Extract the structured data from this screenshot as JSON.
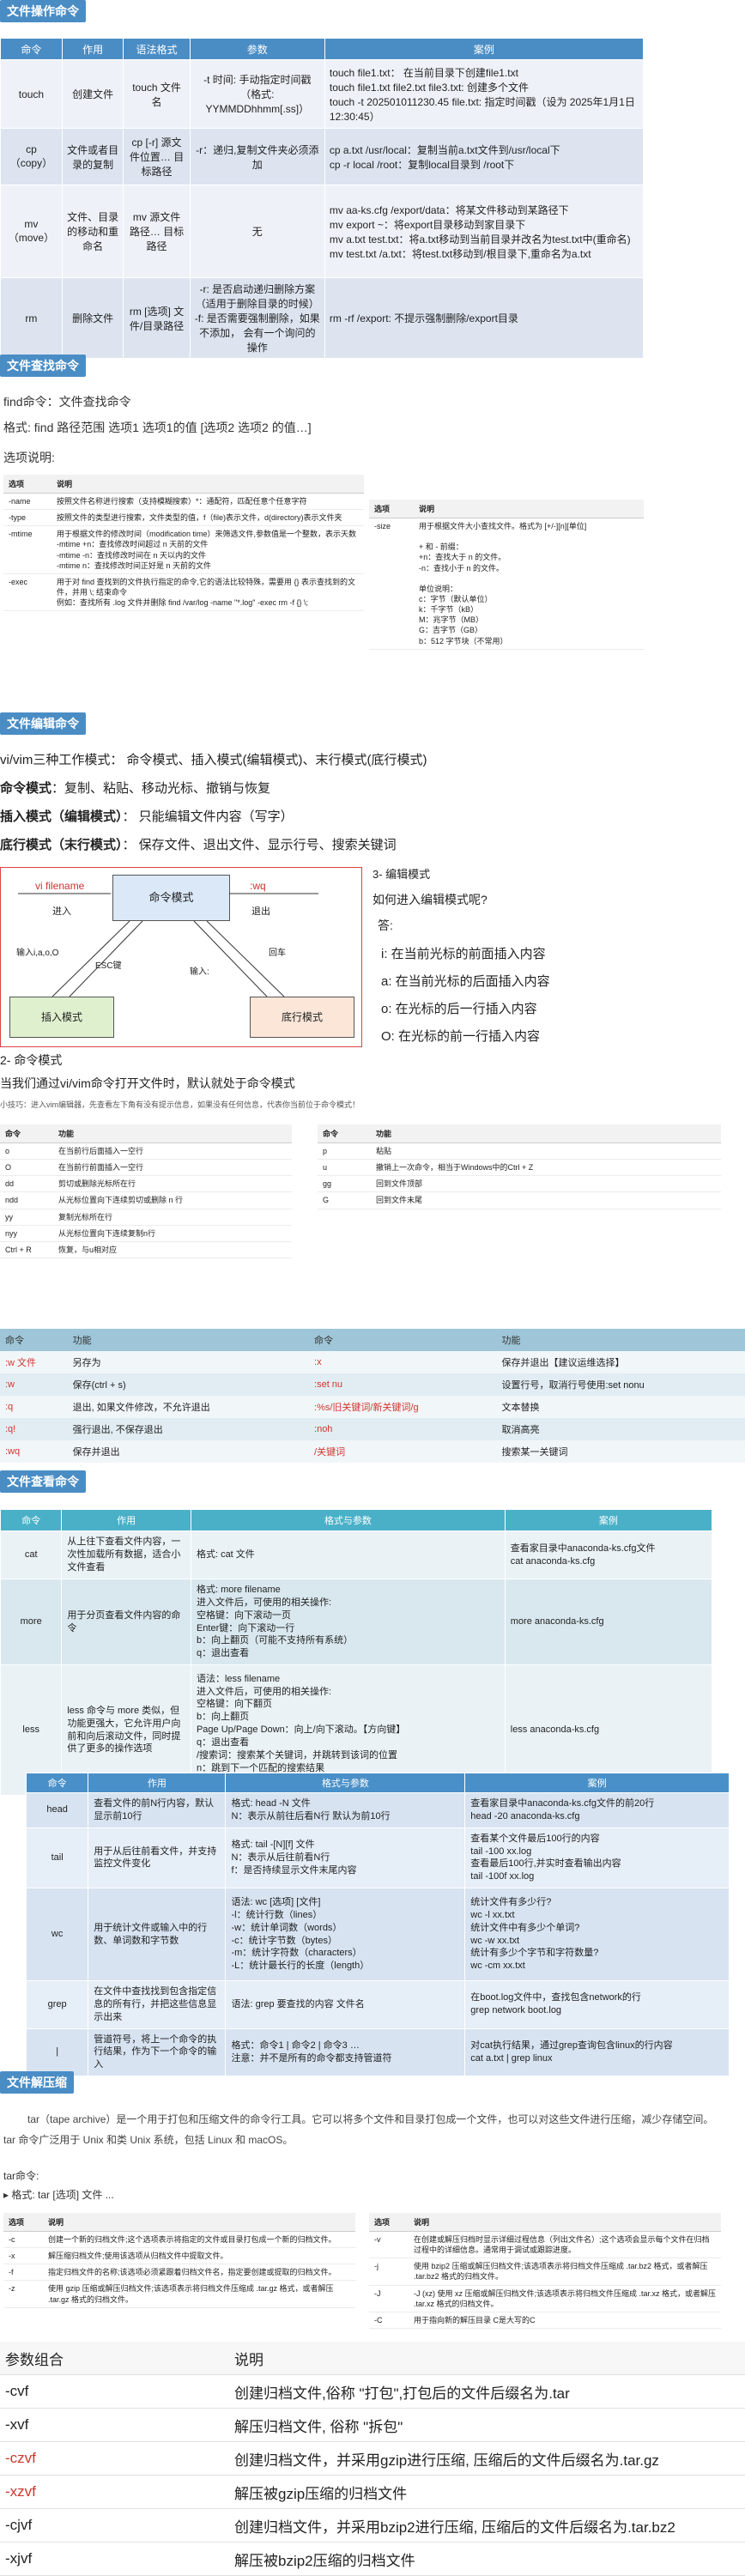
{
  "sec_file_ops": "文件操作命令",
  "t1": {
    "headers": [
      "命令",
      "作用",
      "语法格式",
      "参数",
      "案例"
    ],
    "rows": [
      {
        "cmd": "touch",
        "use": "创建文件",
        "syntax": "touch 文件名",
        "params": "-t 时间: 手动指定时间戳（格式: YYMMDDhhmm[.ss]）",
        "example": "touch file1.txt： 在当前目录下创建file1.txt\ntouch file1.txt file2.txt file3.txt: 创建多个文件\ntouch -t 202501011230.45 file.txt: 指定时间戳（设为 2025年1月1日 12:30:45）"
      },
      {
        "cmd": "cp\n（copy）",
        "use": "文件或者目录的复制",
        "syntax": "cp [-r] 源文件位置… 目标路径",
        "params": "-r：递归,复制文件夹必须添加",
        "example": "cp a.txt /usr/local：复制当前a.txt文件到/usr/local下\ncp -r local /root：复制local目录到 /root下"
      },
      {
        "cmd": "mv\n（move）",
        "use": "文件、目录的移动和重命名",
        "syntax": "mv 源文件路径… 目标路径",
        "params": "无",
        "example": "mv aa-ks.cfg /export/data：将某文件移动到某路径下\nmv export ~：将export目录移动到家目录下\nmv a.txt test.txt：将a.txt移动到当前目录并改名为test.txt中(重命名)\nmv test.txt /a.txt：将test.txt移动到/根目录下,重命名为a.txt"
      },
      {
        "cmd": "rm",
        "use": "删除文件",
        "syntax": "rm [选项] 文件/目录路径",
        "params": "-r: 是否启动递归删除方案（适用于删除目录的时候）\n-f: 是否需要强制删除，如果不添加， 会有一个询问的操作",
        "example": "rm -rf /export: 不提示强制删除/export目录"
      }
    ]
  },
  "sec_find": "文件查找命令",
  "find": {
    "line1": "find命令：文件查找命令",
    "line2": "格式: find  路径范围 选项1 选项1的值  [选项2 选项2 的值…]",
    "line3": "选项说明:",
    "left_headers": [
      "选项",
      "说明"
    ],
    "left_rows": [
      [
        "-name",
        "按照文件名称进行搜索（支持模糊搜索）*：通配符，匹配任意个任意字符"
      ],
      [
        "-type",
        "按照文件的类型进行搜索，文件类型的值，f（file)表示文件，d(directory)表示文件夹"
      ],
      [
        "-mtime",
        "用于根据文件的修改时间（modification time）来筛选文件,参数值是一个整数，表示天数\n-mtime +n：查找修改时间超过 n 天前的文件\n-mtime -n：查找修改时间在 n 天以内的文件\n-mtime n：查找修改时间正好是 n 天前的文件"
      ],
      [
        "-exec",
        "用于对 find 查找到的文件执行指定的命令,它的语法比较特殊，需要用 {} 表示查找到的文件，并用 \\; 结束命令\n例如：查找所有 .log 文件并删除 find /var/log -name \"*.log\" -exec rm -f {} \\;"
      ]
    ],
    "right_headers": [
      "选项",
      "说明"
    ],
    "right_rows": [
      [
        "-size",
        "用于根据文件大小查找文件。格式为 [+/-][n][单位]\n\n+ 和 - 前缀：\n+n：查找大于 n 的文件。\n-n：查找小于 n 的文件。\n\n单位说明：\nc：字节（默认单位）\nk：千字节（kB）\nM：兆字节（MB）\nG：吉字节（GB）\nb：512 字节块（不常用）"
      ]
    ]
  },
  "sec_edit": "文件编辑命令",
  "vim": {
    "l1": "vi/vim三种工作模式： 命令模式、插入模式(编辑模式)、末行模式(底行模式)",
    "l2b": "命令模式",
    "l2": "：复制、粘贴、移动光标、撤销与恢复",
    "l3b": "插入模式（编辑模式）",
    "l3": "： 只能编辑文件内容（写字）",
    "l4b": "底行模式（末行模式）",
    "l4": "： 保存文件、退出文件、显示行号、搜索关键词",
    "diag": {
      "vi": "vi filename",
      "enter": "进入",
      "cmdmode": "命令模式",
      "wq": ":wq",
      "exit": "退出",
      "input": "输入i,a,o,O",
      "esc": "ESC键",
      "enter2": "回车",
      "colon": "输入:",
      "insert": "插入模式",
      "bottom": "底行模式"
    },
    "q3": "3- 编辑模式",
    "q3a": "如何进入编辑模式呢?",
    "ans": "答:",
    "opts": [
      "i:  在当前光标的前面插入内容",
      "a:  在当前光标的后面插入内容",
      "o:  在光标的后一行插入内容",
      "O:  在光标的前一行插入内容"
    ],
    "q2": "2- 命令模式",
    "q2a": "当我们通过vi/vim命令打开文件时，默认就处于命令模式",
    "tip": "小技巧：进入vim编辑器，先查看左下角有没有提示信息，如果没有任何信息，代表你当前位于命令模式！"
  },
  "cmdtbl_left": {
    "headers": [
      "命令",
      "功能"
    ],
    "rows": [
      [
        "o",
        "在当前行后面插入一空行"
      ],
      [
        "O",
        "在当前行前面插入一空行"
      ],
      [
        "dd",
        "剪切或删除光标所在行"
      ],
      [
        "ndd",
        "从光标位置向下连续剪切或删除 n 行"
      ],
      [
        "yy",
        "复制光标所在行"
      ],
      [
        "nyy",
        "从光标位置向下连续复制n行"
      ],
      [
        "Ctrl + R",
        "恢复，与u相对应"
      ]
    ]
  },
  "cmdtbl_right": {
    "headers": [
      "命令",
      "功能"
    ],
    "rows": [
      [
        "p",
        "粘贴"
      ],
      [
        "u",
        "撤销上一次命令，相当于Windows中的Ctrl + Z"
      ],
      [
        "gg",
        "回到文件顶部"
      ],
      [
        "G",
        "回到文件末尾"
      ]
    ]
  },
  "vt": {
    "headers": [
      "命令",
      "功能",
      "命令",
      "功能"
    ],
    "rows": [
      [
        ":w 文件",
        "另存为",
        ":x",
        "保存并退出【建议运维选择】"
      ],
      [
        ":w",
        "保存(ctrl + s)",
        ":set nu",
        "设置行号，取消行号使用:set nonu"
      ],
      [
        ":q",
        "退出, 如果文件修改，不允许退出",
        ":%s/旧关键词/新关键词/g",
        "文本替换"
      ],
      [
        ":q!",
        "强行退出, 不保存退出",
        ":noh",
        "取消高亮"
      ],
      [
        ":wq",
        "保存并退出",
        "/关键词",
        "搜索某一关键词"
      ]
    ]
  },
  "sec_view": "文件查看命令",
  "t2": {
    "headers": [
      "命令",
      "作用",
      "格式与参数",
      "案例"
    ],
    "rows": [
      [
        "cat",
        "从上往下查看文件内容，一次性加载所有数据，适合小文件查看",
        "格式: cat 文件",
        "查看家目录中anaconda-ks.cfg文件\ncat anaconda-ks.cfg"
      ],
      [
        "more",
        "用于分页查看文件内容的命令",
        "格式: more  filename\n进入文件后，可使用的相关操作:\n空格键：向下滚动一页\nEnter键：向下滚动一行\nb：向上翻页（可能不支持所有系统）\nq：退出查看",
        "more anaconda-ks.cfg"
      ],
      [
        "less",
        "less 命令与 more 类似，但功能更强大，它允许用户向前和向后滚动文件，同时提供了更多的操作选项",
        "语法：less  filename\n进入文件后，可使用的相关操作:\n空格键：向下翻页\nb：向上翻页\nPage Up/Page Down：向上/向下滚动。【方向键】\nq：退出查看\n/搜索词：搜索某个关键词，并跳转到该词的位置\nn：跳到下一个匹配的搜索结果\nN：查看前一个匹配的搜索结果",
        "less anaconda-ks.cfg"
      ]
    ]
  },
  "t3": {
    "headers": [
      "命令",
      "作用",
      "格式与参数",
      "案例"
    ],
    "rows": [
      [
        "head",
        "查看文件的前N行内容，默认显示前10行",
        "格式: head -N 文件\nN：表示从前往后看N行 默认为前10行",
        "查看家目录中anaconda-ks.cfg文件的前20行\nhead -20 anaconda-ks.cfg"
      ],
      [
        "tail",
        "用于从后往前看文件，并支持监控文件变化",
        "格式: tail -[N][f] 文件\nN：表示从后往前看N行\nf：是否持续显示文件末尾内容",
        "查看某个文件最后100行的内容\ntail -100 xx.log\n查看最后100行,并实时查看输出内容\ntail -100f xx.log"
      ],
      [
        "wc",
        "用于统计文件或输入中的行数、单词数和字节数",
        "语法: wc [选项] [文件]\n-l：统计行数（lines）\n-w：统计单词数（words）\n-c：统计字节数（bytes）\n-m：统计字符数（characters）\n-L：统计最长行的长度（length）",
        "统计文件有多少行?\nwc -l xx.txt\n统计文件中有多少个单词?\nwc -w xx.txt\n统计有多少个字节和字符数量?\nwc -cm xx.txt"
      ],
      [
        "grep",
        "在文件中查找找到包含指定信息的所有行，并把这些信息显示出来",
        "语法: grep 要查找的内容 文件名",
        "在boot.log文件中，查找包含network的行\ngrep network boot.log"
      ],
      [
        "|",
        "管道符号，将上一个命令的执行结果，作为下一个命令的输入",
        "格式：命令1 | 命令2 | 命令3 …\n注意：并不是所有的命令都支持管道符",
        "对cat执行结果，通过grep查询包含linux的行内容\ncat a.txt | grep linux"
      ]
    ]
  },
  "sec_tar": "文件解压缩",
  "tar": {
    "p1": "tar（tape archive）是一个用于打包和压缩文件的命令行工具。它可以将多个文件和目录打包成一个文件，也可以对这些文件进行压缩，减少存储空间。tar 命令广泛用于 Unix 和类 Unix 系统，包括 Linux 和 macOS。",
    "l1": "tar命令:",
    "l2": "▸ 格式: tar [选项] 文件 ...",
    "left_headers": [
      "选项",
      "说明"
    ],
    "left_rows": [
      [
        "-c",
        "创建一个新的归档文件;这个选项表示将指定的文件或目录打包成一个新的归档文件。"
      ],
      [
        "-x",
        "解压缩归档文件;使用该选项从归档文件中提取文件。"
      ],
      [
        "-f",
        "指定归档文件的名称;该选项必须紧跟着归档文件名，指定要创建或提取的归档文件。"
      ],
      [
        "-z",
        "使用 gzip 压缩或解压归档文件;该选项表示将归档文件压缩成 .tar.gz 格式，或者解压 .tar.gz 格式的归档文件。"
      ]
    ],
    "right_headers": [
      "选项",
      "说明"
    ],
    "right_rows": [
      [
        "-v",
        "在创建或解压归档时显示详细过程信息（列出文件名）;这个选项会显示每个文件在归档过程中的详细信息。通常用于调试或跟踪进度。"
      ],
      [
        "-j",
        "使用 bzip2 压缩或解压归档文件;该选项表示将归档文件压缩成 .tar.bz2 格式，或者解压 .tar.bz2 格式的归档文件。"
      ],
      [
        "-J",
        "-J (xz) 使用 xz 压缩或解压归档文件;该选项表示将归档文件压缩成 .tar.xz 格式，或者解压 .tar.xz 格式的归档文件。"
      ],
      [
        "-C",
        "用于指向新的解压目录 C是大写的C"
      ]
    ]
  },
  "params": {
    "headers": [
      "参数组合",
      "说明"
    ],
    "rows": [
      [
        "-cvf",
        "创建归档文件,俗称 \"打包\",打包后的文件后缀名为.tar"
      ],
      [
        "-xvf",
        "解压归档文件, 俗称 \"拆包\""
      ],
      [
        "-czvf",
        "创建归档文件，并采用gzip进行压缩, 压缩后的文件后缀名为.tar.gz"
      ],
      [
        "-xzvf",
        "解压被gzip压缩的归档文件"
      ],
      [
        "-cjvf",
        "创建归档文件，并采用bzip2进行压缩, 压缩后的文件后缀名为.tar.bz2"
      ],
      [
        "-xjvf",
        "解压被bzip2压缩的归档文件"
      ]
    ]
  }
}
